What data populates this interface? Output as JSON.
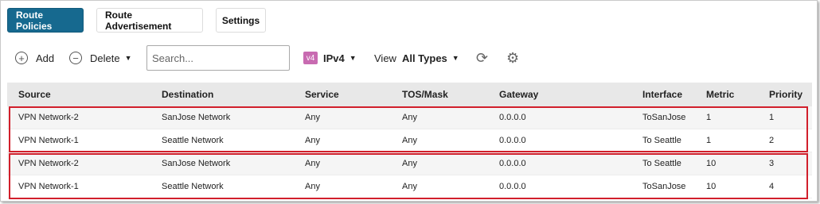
{
  "tabs": [
    {
      "label": "Route Policies",
      "active": true
    },
    {
      "label": "Route Advertisement",
      "active": false
    },
    {
      "label": "Settings",
      "active": false
    }
  ],
  "toolbar": {
    "add_label": "Add",
    "delete_label": "Delete",
    "search_placeholder": "Search...",
    "ip_badge": "v4",
    "ip_version": "IPv4",
    "view_label": "View",
    "view_value": "All Types"
  },
  "table": {
    "headers": {
      "source": "Source",
      "destination": "Destination",
      "service": "Service",
      "tos": "TOS/Mask",
      "gateway": "Gateway",
      "interface": "Interface",
      "metric": "Metric",
      "priority": "Priority"
    },
    "rows": [
      {
        "source": "VPN Network-2",
        "destination": "SanJose Network",
        "service": "Any",
        "tos": "Any",
        "gateway": "0.0.0.0",
        "interface": "ToSanJose",
        "metric": "1",
        "priority": "1"
      },
      {
        "source": "VPN Network-1",
        "destination": "Seattle Network",
        "service": "Any",
        "tos": "Any",
        "gateway": "0.0.0.0",
        "interface": "To Seattle",
        "metric": "1",
        "priority": "2"
      },
      {
        "source": "VPN Network-2",
        "destination": "SanJose Network",
        "service": "Any",
        "tos": "Any",
        "gateway": "0.0.0.0",
        "interface": "To Seattle",
        "metric": "10",
        "priority": "3"
      },
      {
        "source": "VPN Network-1",
        "destination": "Seattle Network",
        "service": "Any",
        "tos": "Any",
        "gateway": "0.0.0.0",
        "interface": "ToSanJose",
        "metric": "10",
        "priority": "4"
      }
    ]
  },
  "colors": {
    "active_tab": "#16698f",
    "highlight_border": "#d11f2b",
    "ip_badge": "#c86bb1"
  }
}
